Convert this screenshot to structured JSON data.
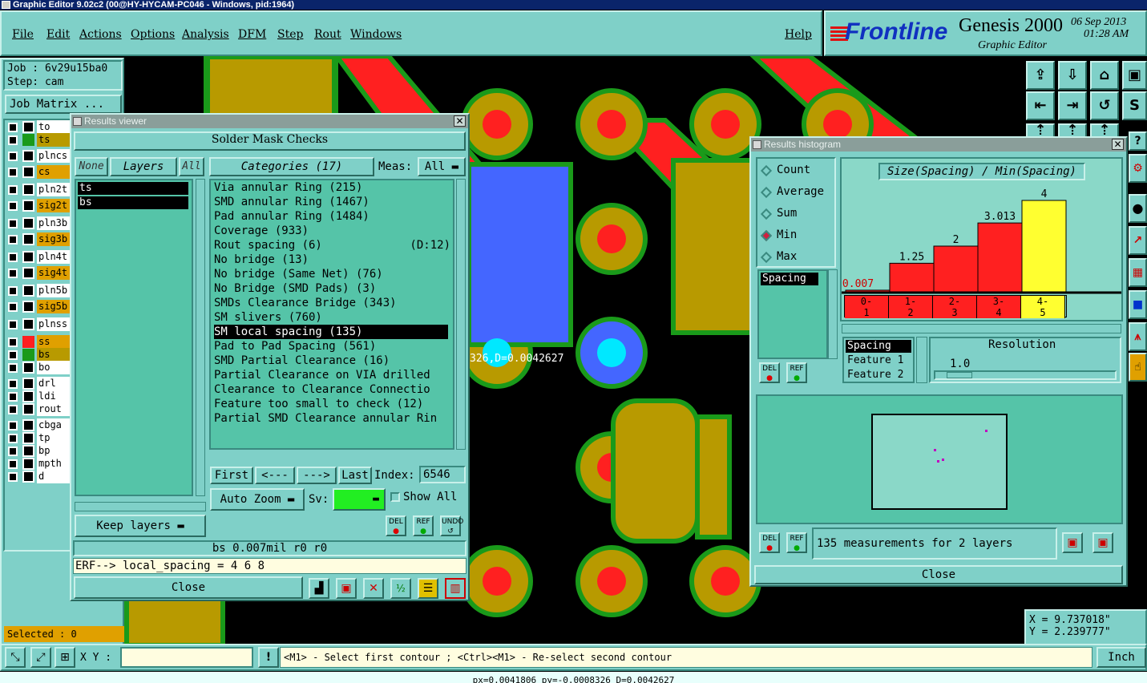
{
  "titlebar": "Graphic Editor 9.02c2 (00@HY-HYCAM-PC046 - Windows, pid:1964)",
  "menu": [
    "File",
    "Edit",
    "Actions",
    "Options",
    "Analysis",
    "DFM",
    "Step",
    "Rout",
    "Windows"
  ],
  "help": "Help",
  "logo": {
    "brand": "Frontline",
    "product": "Genesis 2000",
    "subtitle": "Graphic Editor",
    "date": "06 Sep 2013",
    "time": "01:28 AM"
  },
  "job": {
    "job_label": "Job : 6v29u15ba0",
    "step_label": "Step: cam",
    "matrix_button": "Job Matrix ..."
  },
  "layers": [
    {
      "name": "to",
      "color": "#ffffff",
      "sw": "#000000"
    },
    {
      "name": "ts",
      "color": "#b89a00",
      "sw": "#1a9a1a"
    },
    {
      "name": "plncs",
      "color": "#ffffff",
      "sw": "#000000"
    },
    {
      "name": "cs",
      "color": "#e0a000",
      "sw": "#000000"
    },
    {
      "name": "pln2t",
      "color": "#ffffff",
      "sw": "#000000"
    },
    {
      "name": "sig2t",
      "color": "#e0a000",
      "sw": "#000000"
    },
    {
      "name": "pln3b",
      "color": "#ffffff",
      "sw": "#000000"
    },
    {
      "name": "sig3b",
      "color": "#e0a000",
      "sw": "#000000"
    },
    {
      "name": "pln4t",
      "color": "#ffffff",
      "sw": "#000000"
    },
    {
      "name": "sig4t",
      "color": "#e0a000",
      "sw": "#000000"
    },
    {
      "name": "pln5b",
      "color": "#ffffff",
      "sw": "#000000"
    },
    {
      "name": "sig5b",
      "color": "#e0a000",
      "sw": "#000000"
    },
    {
      "name": "plnss",
      "color": "#ffffff",
      "sw": "#000000"
    },
    {
      "name": "ss",
      "color": "#e0a000",
      "sw": "#ff2020"
    },
    {
      "name": "bs",
      "color": "#b89a00",
      "sw": "#1a9a1a"
    },
    {
      "name": "bo",
      "color": "#ffffff",
      "sw": "#000000"
    },
    {
      "name": "drl",
      "color": "#ffffff",
      "sw": "#000000"
    },
    {
      "name": "ldi",
      "color": "#ffffff",
      "sw": "#000000"
    },
    {
      "name": "rout",
      "color": "#ffffff",
      "sw": "#000000"
    },
    {
      "name": "cbga",
      "color": "#ffffff",
      "sw": "#000000"
    },
    {
      "name": "tp",
      "color": "#ffffff",
      "sw": "#000000"
    },
    {
      "name": "bp",
      "color": "#ffffff",
      "sw": "#000000"
    },
    {
      "name": "mpth",
      "color": "#ffffff",
      "sw": "#000000"
    },
    {
      "name": "d",
      "color": "#ffffff",
      "sw": "#000000"
    }
  ],
  "selected": "Selected : 0",
  "results_viewer": {
    "title": "Results viewer",
    "header": "Solder Mask Checks",
    "none": "None",
    "layers": "Layers",
    "all": "All",
    "layer_list": [
      "ts",
      "bs"
    ],
    "categories_label": "Categories (17)",
    "meas_label": "Meas:",
    "meas_value": "All",
    "categories": [
      "Via annular Ring (215)",
      "SMD annular Ring (1467)",
      "Pad annular Ring (1484)",
      "Coverage (933)",
      "Rout spacing (6)             (D:12)",
      "No bridge (13)",
      "No bridge (Same Net) (76)",
      "No Bridge (SMD Pads) (3)",
      "SMDs Clearance Bridge (343)",
      "SM slivers (760)",
      "SM local spacing (135)",
      "Pad to Pad Spacing (561)",
      "SMD Partial Clearance (16)",
      "Partial Clearance on VIA drilled",
      "Clearance to Clearance Connectio",
      "Feature too small to check (12)",
      "Partial SMD Clearance annular Rin"
    ],
    "selected_index": 10,
    "first": "First",
    "prev": "<---",
    "next": "--->",
    "last": "Last",
    "index_label": "Index:",
    "index_value": "6546",
    "auto_zoom": "Auto Zoom",
    "sv_label": "Sv:",
    "show_all": "Show All",
    "keep_layers": "Keep layers",
    "del": "DEL",
    "ref": "REF",
    "undo": "UNDO",
    "status": "bs 0.007mil  r0  r0",
    "erf": "ERF--> local_spacing = 4 6 8",
    "close": "Close"
  },
  "histogram": {
    "title": "Results histogram",
    "modes": [
      "Count",
      "Average",
      "Sum",
      "Min",
      "Max"
    ],
    "selected_mode": "Min",
    "list": [
      "Spacing"
    ],
    "chart_title": "Size(Spacing) / Min(Spacing)",
    "bar_labels": [
      "0.007",
      "1.25",
      "2",
      "3.013",
      "4"
    ],
    "bins": [
      "0-\n1",
      "1-\n2",
      "2-\n3",
      "3-\n4",
      "4-\n5"
    ],
    "features": [
      "Spacing",
      "Feature 1",
      "Feature 2"
    ],
    "resolution_label": "Resolution",
    "resolution_value": "1.0",
    "measurements": "135 measurements for 2 layers",
    "del": "DEL",
    "ref": "REF",
    "close": "Close"
  },
  "chart_data": {
    "type": "bar",
    "title": "Size(Spacing) / Min(Spacing)",
    "categories": [
      "0-1",
      "1-2",
      "2-3",
      "3-4",
      "4-5"
    ],
    "values": [
      0.007,
      1.25,
      2,
      3.013,
      4
    ],
    "ylim": [
      0,
      4
    ]
  },
  "canvas_readout": "326,D=0.0042627",
  "coords": {
    "x": "X = 9.737018\"",
    "y": "Y = 2.239777\""
  },
  "bottom": {
    "xy_label": "X Y :",
    "xy_value": "",
    "prompt": "<M1> - Select first contour ; <Ctrl><M1> - Re-select second contour",
    "units": "Inch"
  },
  "footer": "px=0.0041806 py=-0.0008326 D=0.0042627"
}
